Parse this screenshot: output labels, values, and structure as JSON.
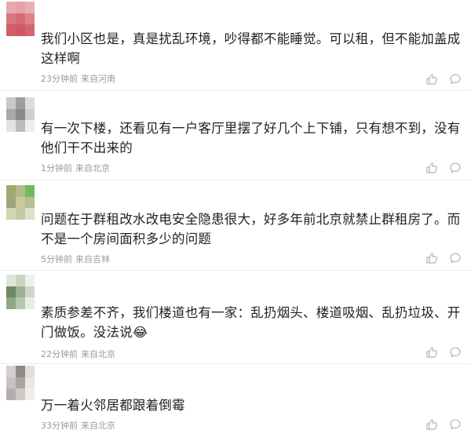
{
  "comments": [
    {
      "avatar_colors": [
        "#e8a9ae",
        "#e4a3a8",
        "#e8b0b4",
        "#d9787f",
        "#d66d74",
        "#dc838a",
        "#d15d66",
        "#cf5860",
        "#d36770"
      ],
      "text": "我们小区也是，真是扰乱环境，吵得都不能睡觉。可以租，但不能加盖成这样啊",
      "time": "23分钟前",
      "location": "来自河南"
    },
    {
      "avatar_colors": [
        "#c9c9c9",
        "#9e9e9e",
        "#dcdcdc",
        "#a9a9a9",
        "#8a8a8a",
        "#cfcfcf",
        "#e3e3e3",
        "#bdbdbd",
        "#eeeeee"
      ],
      "text": "有一次下楼，还看见有一户客厅里摆了好几个上下铺，只有想不到，没有他们干不出来的",
      "time": "1分钟前",
      "location": "来自北京"
    },
    {
      "avatar_colors": [
        "#a3a86e",
        "#b4b98a",
        "#74b85a",
        "#9fa57a",
        "#c7ca9c",
        "#b7bd94",
        "#d2d5b0",
        "#c5c8a5",
        "#dfe0c9"
      ],
      "text": "问题在于群租改水改电安全隐患很大，好多年前北京就禁止群租房了。而不是一个房间面积多少的问题",
      "time": "5分钟前",
      "location": "来自吉林"
    },
    {
      "avatar_colors": [
        "#e1e6dc",
        "#c9d3c2",
        "#eef1ea",
        "#6d8a62",
        "#9db094",
        "#cdd8c7",
        "#8fa683",
        "#b8c8af",
        "#e9eee5"
      ],
      "text": "素质参差不齐，我们楼道也有一家：乱扔烟头、楼道吸烟、乱扔垃圾、开门做饭。没法说😂",
      "time": "22分钟前",
      "location": "来自北京"
    },
    {
      "avatar_colors": [
        "#d4d0cf",
        "#8f8b88",
        "#e1dedd",
        "#c8c3c1",
        "#a8a4a2",
        "#eae7e6",
        "#b3afad",
        "#cdc9c7",
        "#f0eeed"
      ],
      "text": "万一着火邻居都跟着倒霉",
      "time": "33分钟前",
      "location": "来自北京"
    }
  ],
  "icons": {
    "like": "thumbs-up-icon",
    "reply": "comment-bubble-icon"
  },
  "colors": {
    "text": "#222222",
    "meta": "#9a9a9a",
    "icon": "#b5b5b5"
  }
}
